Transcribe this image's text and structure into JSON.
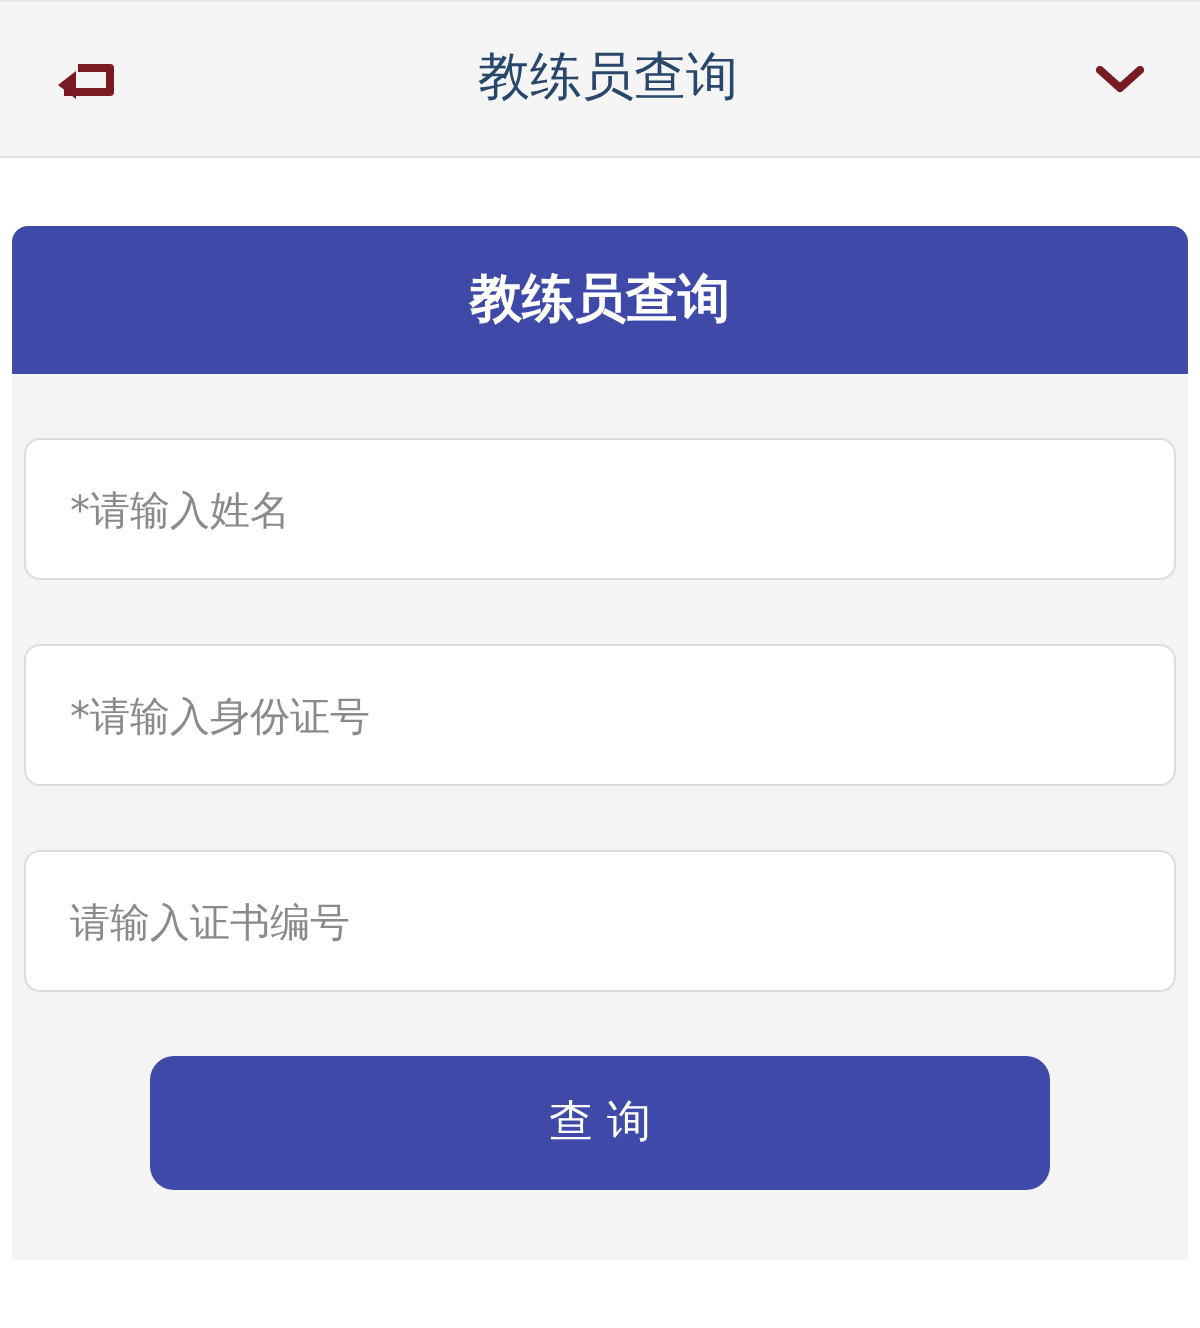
{
  "header": {
    "title": "教练员查询"
  },
  "form": {
    "title": "教练员查询",
    "fields": [
      {
        "placeholder": "*请输入姓名"
      },
      {
        "placeholder": "*请输入身份证号"
      },
      {
        "placeholder": "请输入证书编号"
      }
    ],
    "submit": "查 询"
  }
}
